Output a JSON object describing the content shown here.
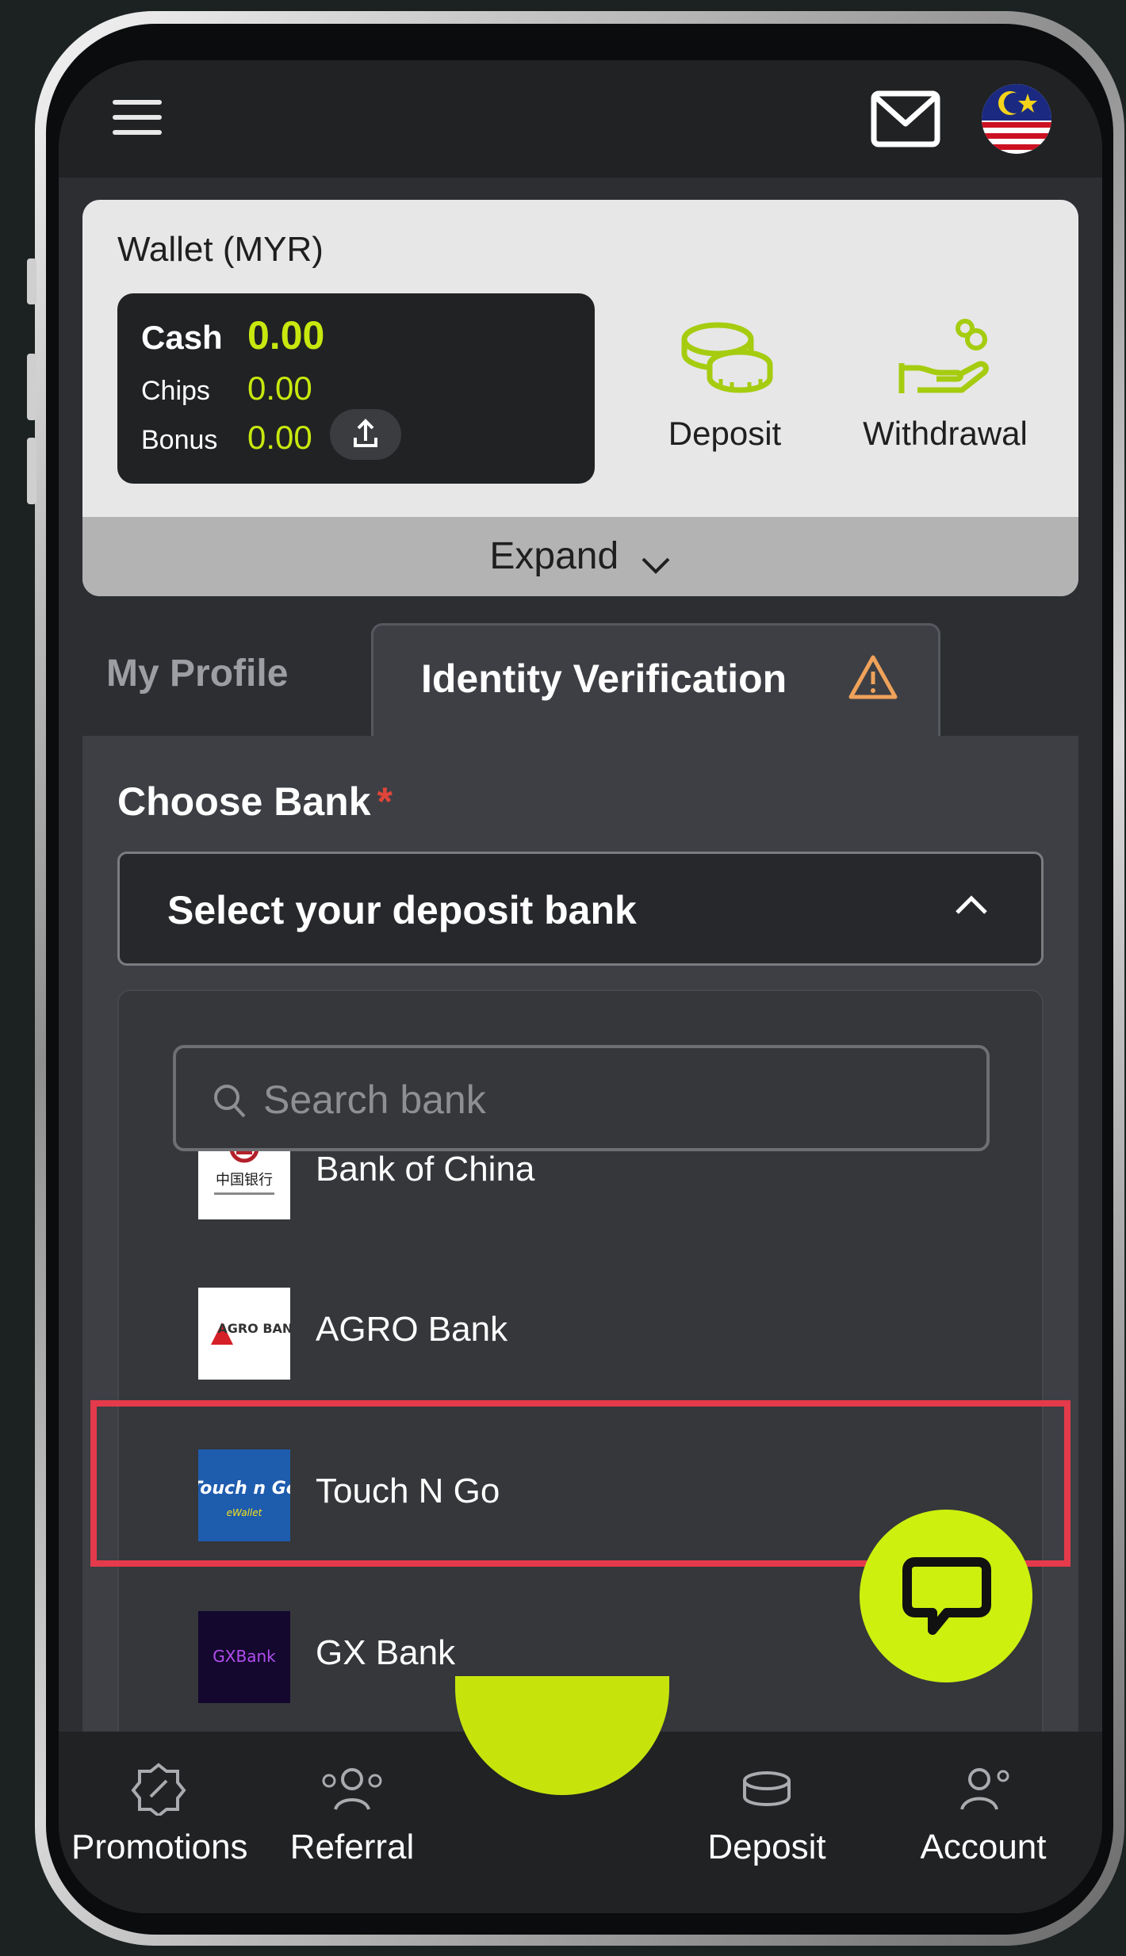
{
  "topbar": {
    "menu_icon": "hamburger-icon",
    "mail_icon": "mail-icon",
    "flag_icon": "malaysia-flag-icon"
  },
  "wallet": {
    "title": "Wallet (MYR)",
    "cash_label": "Cash",
    "cash_value": "0.00",
    "chips_label": "Chips",
    "chips_value": "0.00",
    "bonus_label": "Bonus",
    "bonus_value": "0.00",
    "deposit_label": "Deposit",
    "withdrawal_label": "Withdrawal",
    "expand_label": "Expand",
    "accent": "#c8e80e"
  },
  "tabs": [
    {
      "label": "My Profile",
      "active": false
    },
    {
      "label": "Identity Verification",
      "active": true,
      "icon": "warning-icon"
    }
  ],
  "form": {
    "choose_bank_label": "Choose Bank",
    "required_mark": "*",
    "select_placeholder": "Select your deposit bank",
    "search_placeholder": "Search bank"
  },
  "banks": [
    {
      "name": "Bank of China",
      "logo_text": "中国银行"
    },
    {
      "name": "AGRO Bank",
      "logo_text": "AGRO BANK"
    },
    {
      "name": "Touch N Go",
      "logo_text": "Touch n Go",
      "logo_sub": "eWallet",
      "highlighted": true
    },
    {
      "name": "GX Bank",
      "logo_text": "GXBank"
    }
  ],
  "bottom_nav": [
    {
      "label": "Promotions",
      "icon": "promotion-tag-icon"
    },
    {
      "label": "Referral",
      "icon": "referral-people-icon"
    },
    {
      "label": "Deposit",
      "icon": "coins-icon"
    },
    {
      "label": "Account",
      "icon": "account-settings-icon"
    }
  ],
  "colors": {
    "accent_lime": "#cdf00f",
    "highlight_red": "#e53a4b",
    "warning": "#f0a25a"
  }
}
